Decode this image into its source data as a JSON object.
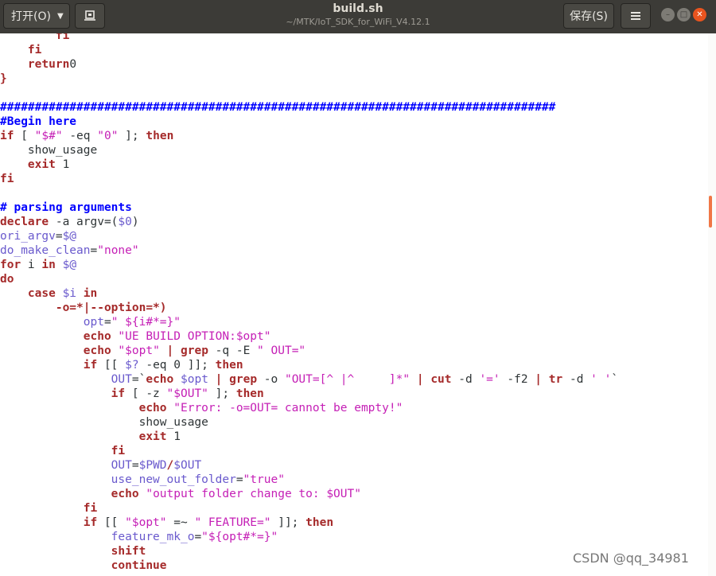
{
  "titlebar": {
    "open_label": "打开(O)",
    "title": "build.sh",
    "subtitle": "~/MTK/IoT_SDK_for_WiFi_V4.12.1",
    "save_label": "保存(S)"
  },
  "code_lines": [
    [
      [
        "kw",
        "        fi"
      ]
    ],
    [
      [
        "kw",
        "    fi"
      ]
    ],
    [
      [
        "kw",
        "    return"
      ],
      [
        "",
        "0"
      ]
    ],
    [
      [
        "kw",
        "}"
      ]
    ],
    [
      [
        "",
        ""
      ]
    ],
    [
      [
        "cm",
        "################################################################################"
      ]
    ],
    [
      [
        "cm",
        "#Begin here"
      ]
    ],
    [
      [
        "kw",
        "if"
      ],
      [
        "",
        " [ "
      ],
      [
        "str",
        "\"$#\""
      ],
      [
        "",
        " -eq "
      ],
      [
        "str",
        "\"0\""
      ],
      [
        "",
        " ]; "
      ],
      [
        "kw",
        "then"
      ]
    ],
    [
      [
        "",
        "    show_usage"
      ]
    ],
    [
      [
        "kw",
        "    exit"
      ],
      [
        "",
        " 1"
      ]
    ],
    [
      [
        "kw",
        "fi"
      ]
    ],
    [
      [
        "",
        ""
      ]
    ],
    [
      [
        "cm",
        "# parsing arguments"
      ]
    ],
    [
      [
        "kw",
        "declare"
      ],
      [
        "",
        " -a argv=("
      ],
      [
        "var",
        "$0"
      ],
      [
        "",
        ")"
      ]
    ],
    [
      [
        "var",
        "ori_argv"
      ],
      [
        "",
        "="
      ],
      [
        "var",
        "$@"
      ]
    ],
    [
      [
        "var",
        "do_make_clean"
      ],
      [
        "",
        "="
      ],
      [
        "str",
        "\"none\""
      ]
    ],
    [
      [
        "kw",
        "for"
      ],
      [
        "",
        " i "
      ],
      [
        "kw",
        "in"
      ],
      [
        "",
        " "
      ],
      [
        "var",
        "$@"
      ]
    ],
    [
      [
        "kw",
        "do"
      ]
    ],
    [
      [
        "kw",
        "    case"
      ],
      [
        "",
        " "
      ],
      [
        "var",
        "$i"
      ],
      [
        "",
        " "
      ],
      [
        "kw",
        "in"
      ]
    ],
    [
      [
        "kw",
        "        -o=*|--option=*)"
      ]
    ],
    [
      [
        "var",
        "            opt"
      ],
      [
        "",
        "="
      ],
      [
        "str",
        "\" ${i#*=}\""
      ]
    ],
    [
      [
        "kw",
        "            echo"
      ],
      [
        "",
        " "
      ],
      [
        "str",
        "\"UE BUILD OPTION:$opt\""
      ]
    ],
    [
      [
        "kw",
        "            echo"
      ],
      [
        "",
        " "
      ],
      [
        "str",
        "\"$opt\""
      ],
      [
        "",
        " "
      ],
      [
        "kw",
        "|"
      ],
      [
        "",
        " "
      ],
      [
        "kw",
        "grep"
      ],
      [
        "",
        " -q -E "
      ],
      [
        "str",
        "\" OUT=\""
      ]
    ],
    [
      [
        "kw",
        "            if"
      ],
      [
        "",
        " [[ "
      ],
      [
        "var",
        "$?"
      ],
      [
        "",
        " -eq 0 ]]; "
      ],
      [
        "kw",
        "then"
      ]
    ],
    [
      [
        "var",
        "                OUT"
      ],
      [
        "",
        "=`"
      ],
      [
        "kw",
        "echo"
      ],
      [
        "",
        " "
      ],
      [
        "var",
        "$opt"
      ],
      [
        "",
        " "
      ],
      [
        "kw",
        "|"
      ],
      [
        "",
        " "
      ],
      [
        "kw",
        "grep"
      ],
      [
        "",
        " -o "
      ],
      [
        "str",
        "\"OUT=[^ |^     ]*\""
      ],
      [
        "",
        " "
      ],
      [
        "kw",
        "|"
      ],
      [
        "",
        " "
      ],
      [
        "kw",
        "cut"
      ],
      [
        "",
        " -d "
      ],
      [
        "str",
        "'='"
      ],
      [
        "",
        " -f2 "
      ],
      [
        "kw",
        "|"
      ],
      [
        "",
        " "
      ],
      [
        "kw",
        "tr"
      ],
      [
        "",
        " -d "
      ],
      [
        "str",
        "' '"
      ],
      [
        "",
        "`"
      ]
    ],
    [
      [
        "kw",
        "                if"
      ],
      [
        "",
        " [ -z "
      ],
      [
        "str",
        "\"$OUT\""
      ],
      [
        "",
        " ]; "
      ],
      [
        "kw",
        "then"
      ]
    ],
    [
      [
        "kw",
        "                    echo"
      ],
      [
        "",
        " "
      ],
      [
        "str",
        "\"Error: -o=OUT= cannot be empty!\""
      ]
    ],
    [
      [
        "",
        "                    show_usage"
      ]
    ],
    [
      [
        "kw",
        "                    exit"
      ],
      [
        "",
        " 1"
      ]
    ],
    [
      [
        "kw",
        "                fi"
      ]
    ],
    [
      [
        "var",
        "                OUT"
      ],
      [
        "",
        "="
      ],
      [
        "var",
        "$PWD"
      ],
      [
        "kw",
        "/"
      ],
      [
        "var",
        "$OUT"
      ]
    ],
    [
      [
        "var",
        "                use_new_out_folder"
      ],
      [
        "",
        "="
      ],
      [
        "str",
        "\"true\""
      ]
    ],
    [
      [
        "kw",
        "                echo"
      ],
      [
        "",
        " "
      ],
      [
        "str",
        "\"output folder change to: $OUT\""
      ]
    ],
    [
      [
        "kw",
        "            fi"
      ]
    ],
    [
      [
        "kw",
        "            if"
      ],
      [
        "",
        " [[ "
      ],
      [
        "str",
        "\"$opt\""
      ],
      [
        "",
        " =~ "
      ],
      [
        "str",
        "\" FEATURE=\""
      ],
      [
        "",
        " ]]; "
      ],
      [
        "kw",
        "then"
      ]
    ],
    [
      [
        "var",
        "                feature_mk_o"
      ],
      [
        "",
        "="
      ],
      [
        "str",
        "\"${opt#*=}\""
      ]
    ],
    [
      [
        "kw",
        "                shift"
      ]
    ],
    [
      [
        "kw",
        "                continue"
      ]
    ]
  ],
  "watermark": "CSDN @qq_34981",
  "icons": {
    "pin": "pin-icon",
    "menu": "hamburger-menu-icon",
    "minimize": "minimize-icon",
    "maximize": "maximize-icon",
    "close": "close-icon"
  }
}
